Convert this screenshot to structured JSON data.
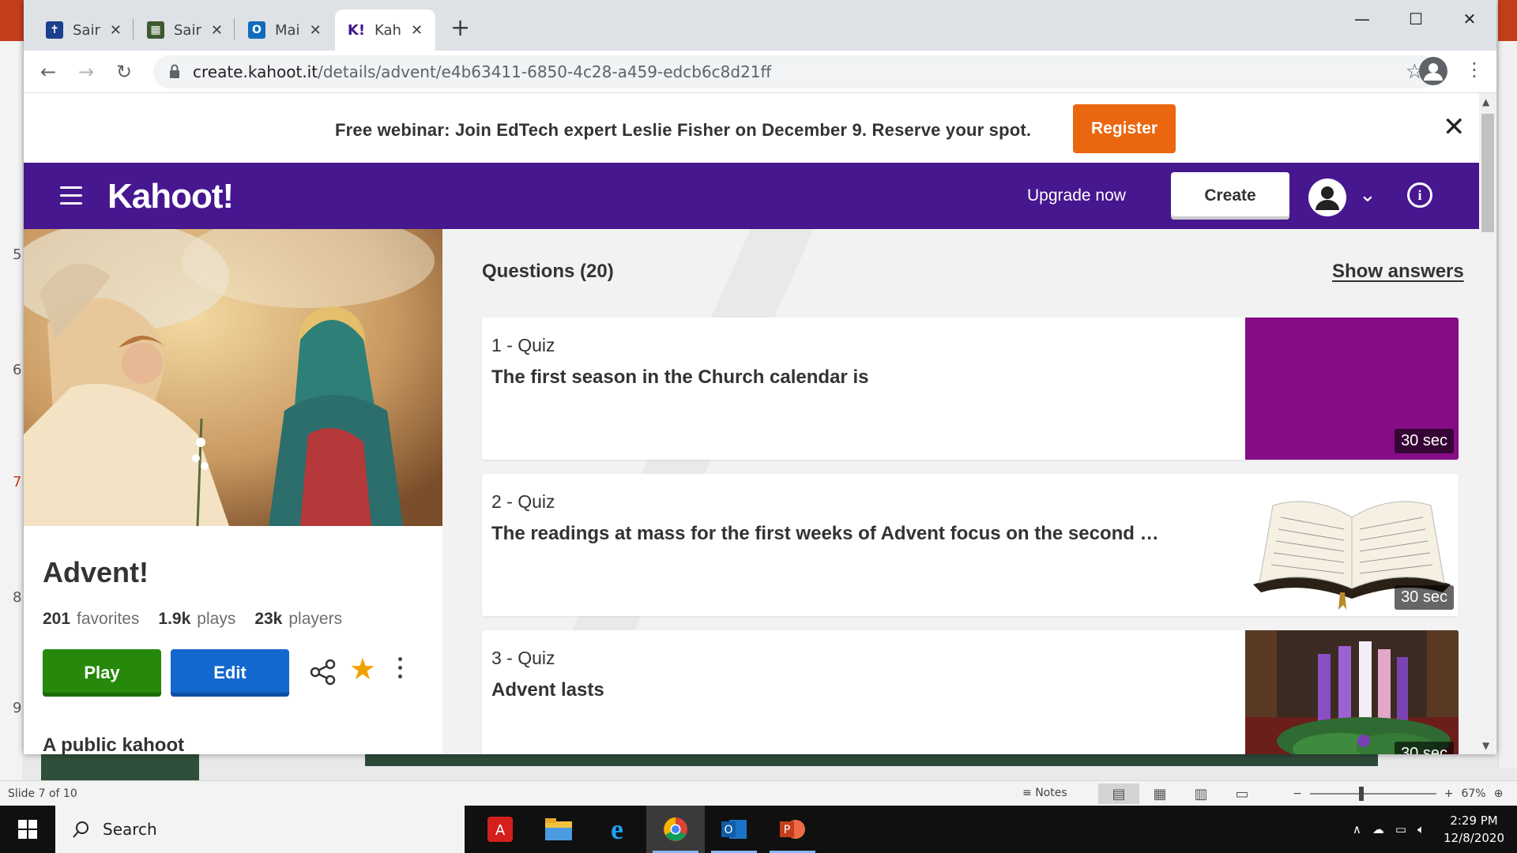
{
  "browser": {
    "tabs": [
      {
        "label": "Sair",
        "favicon": "cross-icon",
        "color": "#1a3f8c"
      },
      {
        "label": "Sair",
        "favicon": "mosaic-icon",
        "color": "#3b5a2d"
      },
      {
        "label": "Mai",
        "favicon": "outlook-icon",
        "color": "#0f6cbd"
      },
      {
        "label": "Kah",
        "favicon": "kahoot-icon",
        "color": "#46178f"
      }
    ],
    "url_host": "create.kahoot.it",
    "url_path": "/details/advent/e4b63411-6850-4c28-a459-edcb6c8d21ff"
  },
  "banner": {
    "text": "Free webinar: Join EdTech expert Leslie Fisher on December 9. Reserve your spot.",
    "register_label": "Register"
  },
  "header": {
    "logo": "Kahoot!",
    "upgrade_label": "Upgrade now",
    "create_label": "Create"
  },
  "kahoot": {
    "title": "Advent!",
    "favorites_count": "201",
    "favorites_label": "favorites",
    "plays_count": "1.9k",
    "plays_label": "plays",
    "players_count": "23k",
    "players_label": "players",
    "play_label": "Play",
    "edit_label": "Edit",
    "visibility": "A public kahoot"
  },
  "questions": {
    "heading": "Questions (20)",
    "show_answers_label": "Show answers",
    "items": [
      {
        "type": "1 - Quiz",
        "text": "The first season in the Church calendar is",
        "time": "30 sec",
        "image": "purple-block",
        "bg": "#860d86"
      },
      {
        "type": "2 - Quiz",
        "text": "The readings at mass for the first weeks of Advent focus on the second …",
        "time": "30 sec",
        "image": "open-bible",
        "bg": "#ffffff"
      },
      {
        "type": "3 - Quiz",
        "text": "Advent lasts",
        "time": "30 sec",
        "image": "advent-wreath",
        "bg": "#3a2a20"
      }
    ]
  },
  "powerpoint": {
    "slide_status": "Slide 7 of 10",
    "notes_label": "Notes",
    "zoom_level": "67%",
    "thumb_numbers": [
      "5",
      "6",
      "7",
      "8",
      "9"
    ]
  },
  "taskbar": {
    "search_label": "Search",
    "time": "2:29 PM",
    "date": "12/8/2020"
  }
}
